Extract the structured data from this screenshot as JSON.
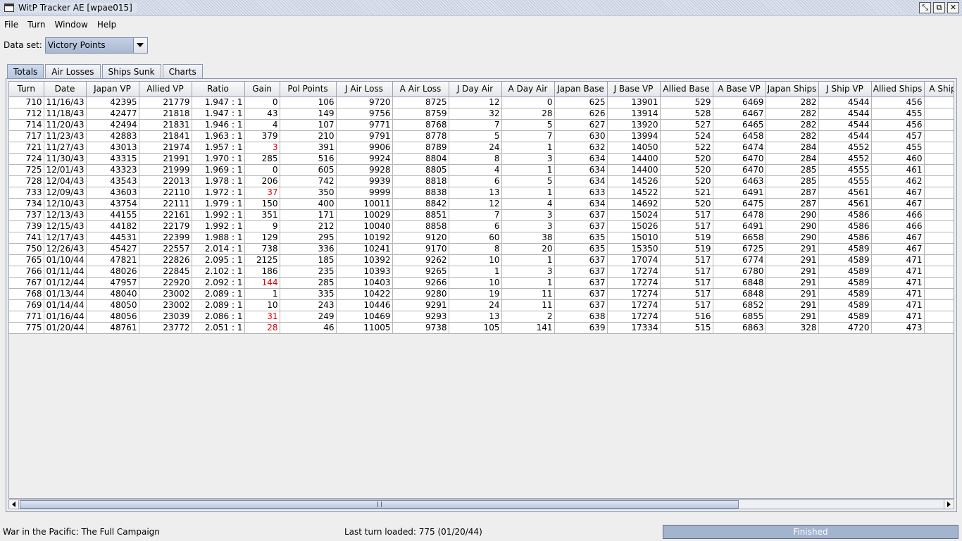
{
  "window": {
    "title": "WitP Tracker AE [wpae015]"
  },
  "menu": [
    {
      "label": "File"
    },
    {
      "label": "Turn"
    },
    {
      "label": "Window"
    },
    {
      "label": "Help"
    }
  ],
  "dataset": {
    "label": "Data set:",
    "value": "Victory Points"
  },
  "tabs": [
    {
      "label": "Totals",
      "active": true
    },
    {
      "label": "Air Losses"
    },
    {
      "label": "Ships Sunk"
    },
    {
      "label": "Charts"
    }
  ],
  "table": {
    "columns": [
      "Turn",
      "Date",
      "Japan VP",
      "Allied VP",
      "Ratio",
      "Gain",
      "Pol Points",
      "J Air Loss",
      "A Air Loss",
      "J Day Air",
      "A Day Air",
      "Japan Base",
      "J Base VP",
      "Allied Base",
      "A Base VP",
      "Japan Ships",
      "J Ship VP",
      "Allied Ships",
      "A Ship"
    ],
    "rows": [
      [
        "710",
        "11/16/43",
        "42395",
        "21779",
        "1.947 : 1",
        "0",
        "106",
        "9720",
        "8725",
        "12",
        "0",
        "625",
        "13901",
        "529",
        "6469",
        "282",
        "4544",
        "456",
        ""
      ],
      [
        "712",
        "11/18/43",
        "42477",
        "21818",
        "1.947 : 1",
        "43",
        "149",
        "9756",
        "8759",
        "32",
        "28",
        "626",
        "13914",
        "528",
        "6467",
        "282",
        "4544",
        "455",
        ""
      ],
      [
        "714",
        "11/20/43",
        "42494",
        "21831",
        "1.946 : 1",
        "4",
        "107",
        "9771",
        "8768",
        "7",
        "5",
        "627",
        "13920",
        "527",
        "6465",
        "282",
        "4544",
        "456",
        ""
      ],
      [
        "717",
        "11/23/43",
        "42883",
        "21841",
        "1.963 : 1",
        "379",
        "210",
        "9791",
        "8778",
        "5",
        "7",
        "630",
        "13994",
        "524",
        "6458",
        "282",
        "4544",
        "457",
        ""
      ],
      [
        "721",
        "11/27/43",
        "43013",
        "21974",
        "1.957 : 1",
        "3",
        "391",
        "9906",
        "8789",
        "24",
        "1",
        "632",
        "14050",
        "522",
        "6474",
        "284",
        "4552",
        "455",
        ""
      ],
      [
        "724",
        "11/30/43",
        "43315",
        "21991",
        "1.970 : 1",
        "285",
        "516",
        "9924",
        "8804",
        "8",
        "3",
        "634",
        "14400",
        "520",
        "6470",
        "284",
        "4552",
        "460",
        ""
      ],
      [
        "725",
        "12/01/43",
        "43323",
        "21999",
        "1.969 : 1",
        "0",
        "605",
        "9928",
        "8805",
        "4",
        "1",
        "634",
        "14400",
        "520",
        "6470",
        "285",
        "4555",
        "461",
        ""
      ],
      [
        "728",
        "12/04/43",
        "43543",
        "22013",
        "1.978 : 1",
        "206",
        "742",
        "9939",
        "8818",
        "6",
        "5",
        "634",
        "14526",
        "520",
        "6463",
        "285",
        "4555",
        "462",
        ""
      ],
      [
        "733",
        "12/09/43",
        "43603",
        "22110",
        "1.972 : 1",
        "37",
        "350",
        "9999",
        "8838",
        "13",
        "1",
        "633",
        "14522",
        "521",
        "6491",
        "287",
        "4561",
        "467",
        ""
      ],
      [
        "734",
        "12/10/43",
        "43754",
        "22111",
        "1.979 : 1",
        "150",
        "400",
        "10011",
        "8842",
        "12",
        "4",
        "634",
        "14692",
        "520",
        "6475",
        "287",
        "4561",
        "467",
        ""
      ],
      [
        "737",
        "12/13/43",
        "44155",
        "22161",
        "1.992 : 1",
        "351",
        "171",
        "10029",
        "8851",
        "7",
        "3",
        "637",
        "15024",
        "517",
        "6478",
        "290",
        "4586",
        "466",
        ""
      ],
      [
        "739",
        "12/15/43",
        "44182",
        "22179",
        "1.992 : 1",
        "9",
        "212",
        "10040",
        "8858",
        "6",
        "3",
        "637",
        "15026",
        "517",
        "6491",
        "290",
        "4586",
        "466",
        ""
      ],
      [
        "741",
        "12/17/43",
        "44531",
        "22399",
        "1.988 : 1",
        "129",
        "295",
        "10192",
        "9120",
        "60",
        "38",
        "635",
        "15010",
        "519",
        "6658",
        "290",
        "4586",
        "467",
        ""
      ],
      [
        "750",
        "12/26/43",
        "45427",
        "22557",
        "2.014 : 1",
        "738",
        "336",
        "10241",
        "9170",
        "8",
        "20",
        "635",
        "15350",
        "519",
        "6725",
        "291",
        "4589",
        "467",
        ""
      ],
      [
        "765",
        "01/10/44",
        "47821",
        "22826",
        "2.095 : 1",
        "2125",
        "185",
        "10392",
        "9262",
        "10",
        "1",
        "637",
        "17074",
        "517",
        "6774",
        "291",
        "4589",
        "471",
        ""
      ],
      [
        "766",
        "01/11/44",
        "48026",
        "22845",
        "2.102 : 1",
        "186",
        "235",
        "10393",
        "9265",
        "1",
        "3",
        "637",
        "17274",
        "517",
        "6780",
        "291",
        "4589",
        "471",
        ""
      ],
      [
        "767",
        "01/12/44",
        "47957",
        "22920",
        "2.092 : 1",
        "144",
        "285",
        "10403",
        "9266",
        "10",
        "1",
        "637",
        "17274",
        "517",
        "6848",
        "291",
        "4589",
        "471",
        ""
      ],
      [
        "768",
        "01/13/44",
        "48040",
        "23002",
        "2.089 : 1",
        "1",
        "335",
        "10422",
        "9280",
        "19",
        "11",
        "637",
        "17274",
        "517",
        "6848",
        "291",
        "4589",
        "471",
        ""
      ],
      [
        "769",
        "01/14/44",
        "48050",
        "23002",
        "2.089 : 1",
        "10",
        "243",
        "10446",
        "9291",
        "24",
        "11",
        "637",
        "17274",
        "517",
        "6852",
        "291",
        "4589",
        "471",
        ""
      ],
      [
        "771",
        "01/16/44",
        "48056",
        "23039",
        "2.086 : 1",
        "31",
        "249",
        "10469",
        "9293",
        "13",
        "2",
        "638",
        "17274",
        "516",
        "6855",
        "291",
        "4589",
        "471",
        ""
      ],
      [
        "775",
        "01/20/44",
        "48761",
        "23772",
        "2.051 : 1",
        "28",
        "46",
        "11005",
        "9738",
        "105",
        "141",
        "639",
        "17334",
        "515",
        "6863",
        "328",
        "4720",
        "473",
        ""
      ]
    ],
    "negative_gain_rows": [
      4,
      8,
      16,
      19,
      20
    ],
    "negative_color": "#dd0000"
  },
  "status": {
    "left": "War in the Pacific: The Full Campaign",
    "middle": "Last turn loaded: 775 (01/20/44)",
    "progress_label": "Finished",
    "progress_fraction": 1.0
  }
}
